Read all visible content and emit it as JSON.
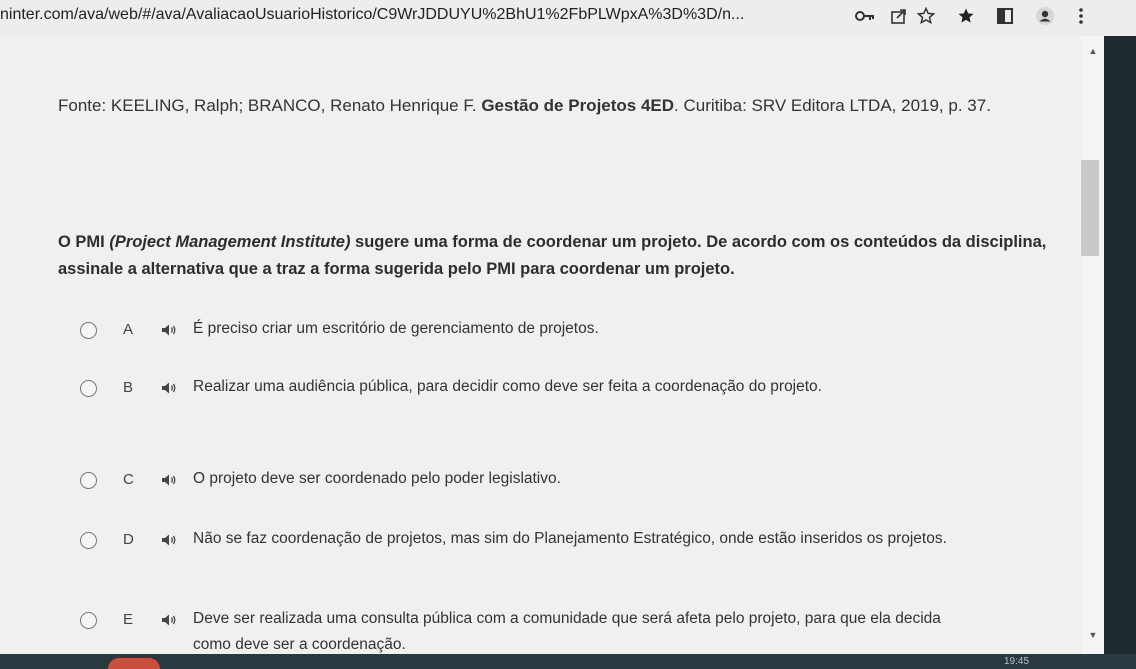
{
  "browser": {
    "url": "ninter.com/ava/web/#/ava/AvaliacaoUsuarioHistorico/C9WrJDDUYU%2BhU1%2FbPLWpxA%3D%3D/n...",
    "icons": [
      "key-icon",
      "share-icon",
      "star-icon",
      "extension-icon",
      "window-icon",
      "profile-icon",
      "menu-icon"
    ]
  },
  "source": {
    "prefix": "Fonte: KEELING, Ralph; BRANCO, Renato Henrique F. ",
    "title": "Gestão de Projetos 4ED",
    "suffix": ". Curitiba: SRV Editora LTDA, 2019, p. 37."
  },
  "question": {
    "part1": "O PMI ",
    "italic": "(Project Management Institute)",
    "part2": " sugere uma forma de coordenar um projeto. De acordo com os conteúdos da disciplina, assinale a alternativa que a traz a forma sugerida pelo PMI para coordenar um projeto."
  },
  "options": [
    {
      "letter": "A",
      "text": "É preciso criar um escritório de gerenciamento de projetos."
    },
    {
      "letter": "B",
      "text": "Realizar uma audiência pública, para decidir como deve ser feita a coordenação do projeto."
    },
    {
      "letter": "C",
      "text": "O projeto deve ser coordenado pelo poder legislativo."
    },
    {
      "letter": "D",
      "text": "Não se faz coordenação de projetos, mas sim do Planejamento Estratégico, onde estão inseridos os projetos."
    },
    {
      "letter": "E",
      "text": "Deve ser realizada uma consulta pública com a comunidade que será afeta pelo projeto, para que ela decida como deve ser a coordenação."
    }
  ],
  "taskbar": {
    "clock": "19:45"
  },
  "colors": {
    "background": "#f1f0ef",
    "text": "#333333",
    "taskbar": "#2a3940"
  }
}
